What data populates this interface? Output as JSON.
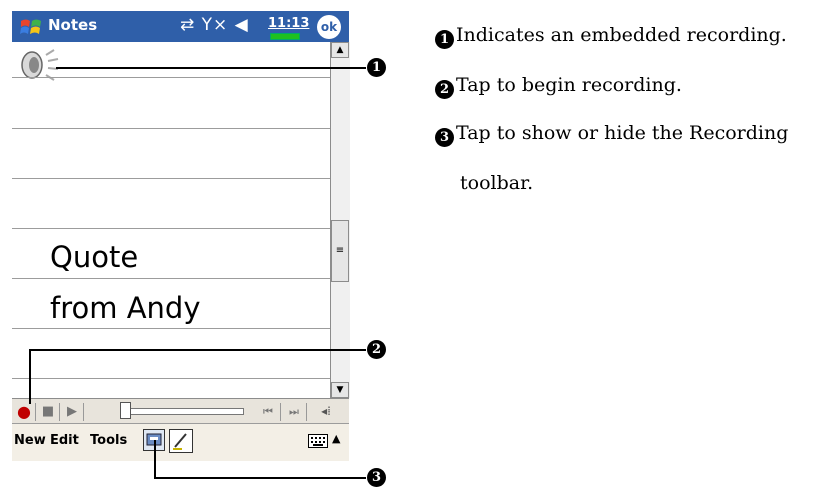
{
  "titlebar": {
    "app_title": "Notes",
    "status_icons": "⇄ Y× ◀",
    "clock": "11:13",
    "ok_label": "ok"
  },
  "note": {
    "line1": "Quote",
    "line2": "from Andy"
  },
  "menubar": {
    "new_label": "New",
    "edit_label": "Edit",
    "tools_label": "Tools"
  },
  "callouts": {
    "c1": "1",
    "c2": "2",
    "c3": "3"
  },
  "legend": {
    "item1": "Indicates an embedded recording.",
    "item2": "Tap to begin recording.",
    "item3_line1": "Tap to show or hide the Recording",
    "item3_line2": "toolbar."
  },
  "icons": [
    "windows-start-icon",
    "speaker-icon",
    "record-icon",
    "stop-icon",
    "play-icon",
    "rewind-icon",
    "fast-forward-icon",
    "volume-icon",
    "recording-toolbar-icon",
    "pen-icon",
    "keyboard-icon"
  ],
  "colors": {
    "titlebar": "#2f5fa9",
    "record": "#c00000",
    "battery": "#1fc01f"
  }
}
